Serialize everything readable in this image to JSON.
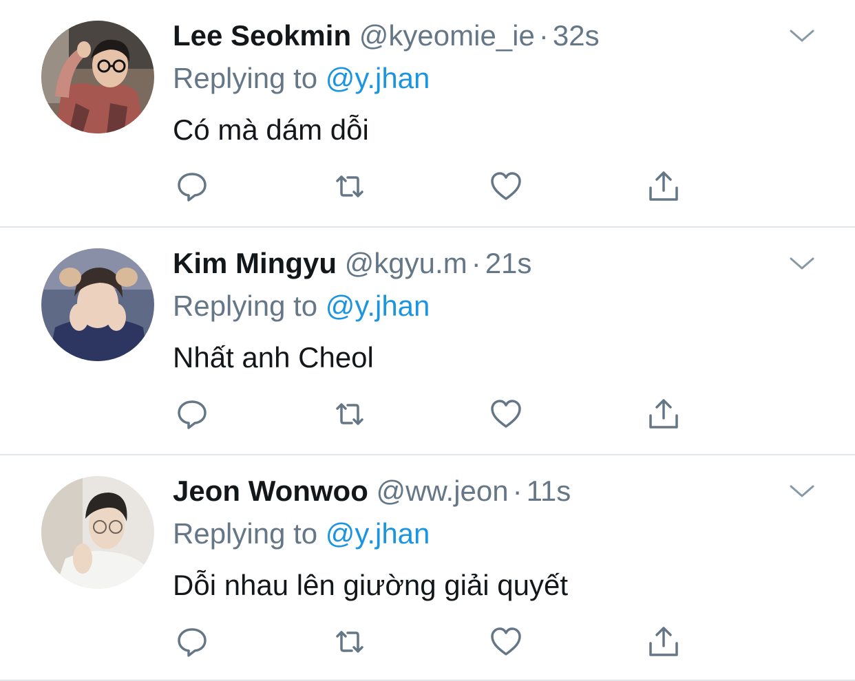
{
  "colors": {
    "name": "#14171a",
    "muted": "#657786",
    "mention": "#1b95e0",
    "divider": "#e1e6ea",
    "icon": "#657786"
  },
  "icons": {
    "reply": "reply-icon",
    "retweet": "retweet-icon",
    "like": "heart-icon",
    "share": "share-icon",
    "more": "chevron-down-icon"
  },
  "tweets": [
    {
      "name": "Lee Seokmin",
      "handle": "@kyeomie_ie",
      "separator": "·",
      "time": "32s",
      "replying_prefix": "Replying to ",
      "replying_to": "@y.jhan",
      "text": "Có mà dám dỗi"
    },
    {
      "name": "Kim Mingyu",
      "handle": "@kgyu.m",
      "separator": "·",
      "time": "21s",
      "replying_prefix": "Replying to ",
      "replying_to": "@y.jhan",
      "text": "Nhất anh Cheol"
    },
    {
      "name": "Jeon Wonwoo",
      "handle": "@ww.jeon",
      "separator": "·",
      "time": "11s",
      "replying_prefix": "Replying to ",
      "replying_to": "@y.jhan",
      "text": "Dỗi nhau lên giường giải quyết"
    }
  ]
}
